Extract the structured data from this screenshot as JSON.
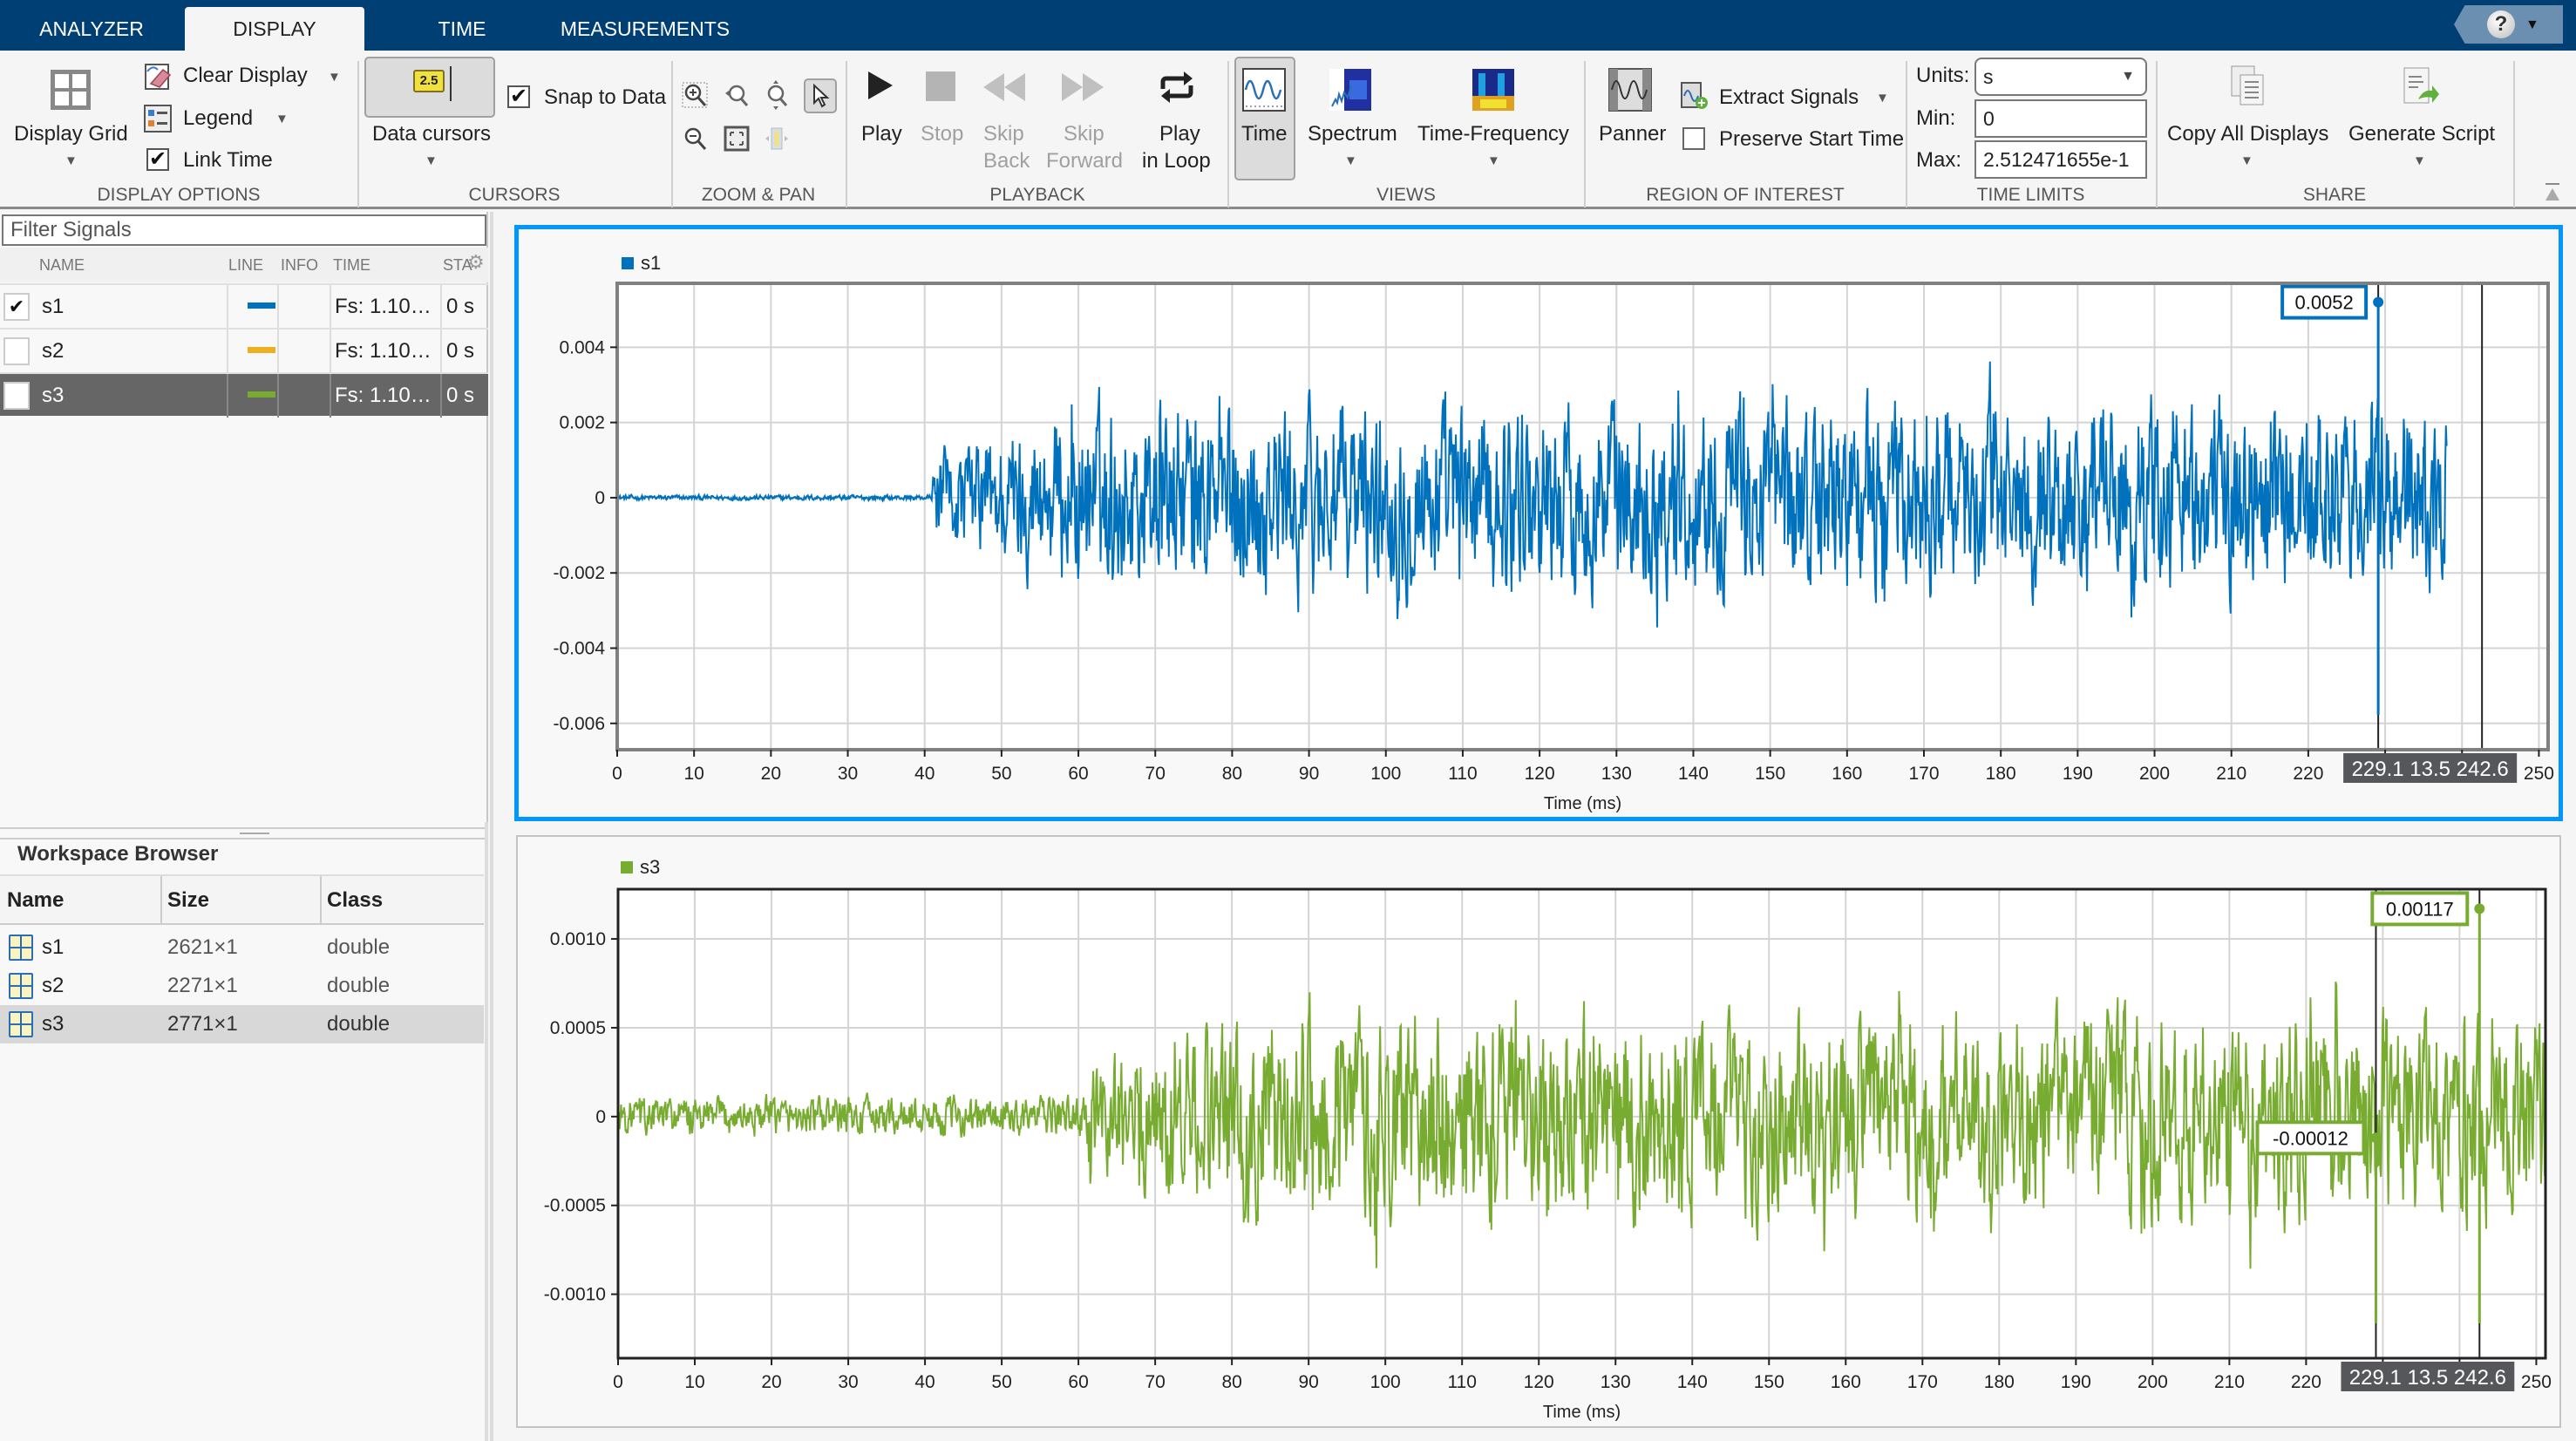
{
  "tabs": [
    {
      "label": "ANALYZER",
      "active": false
    },
    {
      "label": "DISPLAY",
      "active": true
    },
    {
      "label": "TIME",
      "active": false
    },
    {
      "label": "MEASUREMENTS",
      "active": false
    }
  ],
  "help_label": "?",
  "toolbar": {
    "display_options": {
      "section_label": "DISPLAY OPTIONS",
      "display_grid": "Display Grid",
      "clear_display": "Clear Display",
      "legend": "Legend",
      "link_time": "Link Time",
      "link_time_checked": true
    },
    "cursors": {
      "section_label": "CURSORS",
      "data_cursors": "Data cursors",
      "data_cursors_icon_text": "2.5",
      "snap_to_data": "Snap to Data",
      "snap_to_data_checked": true
    },
    "zoom_pan": {
      "section_label": "ZOOM & PAN"
    },
    "playback": {
      "section_label": "PLAYBACK",
      "play": "Play",
      "stop": "Stop",
      "skip_back_1": "Skip",
      "skip_back_2": "Back",
      "skip_forward_1": "Skip",
      "skip_forward_2": "Forward",
      "play_loop_1": "Play",
      "play_loop_2": "in Loop"
    },
    "views": {
      "section_label": "VIEWS",
      "time": "Time",
      "spectrum": "Spectrum",
      "time_frequency": "Time-Frequency"
    },
    "roi": {
      "section_label": "REGION OF INTEREST",
      "panner": "Panner",
      "extract_signals": "Extract Signals",
      "preserve_start_time": "Preserve Start Time",
      "preserve_start_time_checked": false
    },
    "time_limits": {
      "section_label": "TIME LIMITS",
      "units_label": "Units:",
      "units_value": "s",
      "min_label": "Min:",
      "min_value": "0",
      "max_label": "Max:",
      "max_value": "2.512471655e-1"
    },
    "share": {
      "section_label": "SHARE",
      "copy_all": "Copy All Displays",
      "generate_script": "Generate Script"
    }
  },
  "signals_panel": {
    "filter_placeholder": "Filter Signals",
    "columns": [
      "NAME",
      "LINE",
      "INFO",
      "TIME",
      "STA"
    ],
    "rows": [
      {
        "name": "s1",
        "checked": true,
        "color": "#0072bd",
        "time": "Fs: 1.10…",
        "start": "0 s",
        "selected": false
      },
      {
        "name": "s2",
        "checked": false,
        "color": "#edb120",
        "time": "Fs: 1.10…",
        "start": "0 s",
        "selected": false
      },
      {
        "name": "s3",
        "checked": false,
        "color": "#77ac30",
        "time": "Fs: 1.10…",
        "start": "0 s",
        "selected": true
      }
    ]
  },
  "workspace": {
    "title": "Workspace Browser",
    "columns": [
      "Name",
      "Size",
      "Class"
    ],
    "rows": [
      {
        "name": "s1",
        "size": "2621×1",
        "class": "double",
        "selected": false
      },
      {
        "name": "s2",
        "size": "2271×1",
        "class": "double",
        "selected": false
      },
      {
        "name": "s3",
        "size": "2771×1",
        "class": "double",
        "selected": true
      }
    ]
  },
  "chart_data": [
    {
      "type": "line",
      "title": "",
      "legend": [
        "s1"
      ],
      "legend_placement": "top-left",
      "color": "#0072bd",
      "xlabel": "Time (ms)",
      "ylabel": "",
      "xlim": [
        0,
        251.2
      ],
      "ylim": [
        -0.0067,
        0.0057
      ],
      "xticks": [
        0,
        10,
        20,
        30,
        40,
        50,
        60,
        70,
        80,
        90,
        100,
        110,
        120,
        130,
        140,
        150,
        160,
        170,
        180,
        190,
        200,
        210,
        220,
        230,
        240,
        250
      ],
      "xtick_labels": [
        "0",
        "10",
        "20",
        "30",
        "40",
        "50",
        "60",
        "70",
        "80",
        "90",
        "100",
        "110",
        "120",
        "130",
        "140",
        "150",
        "160",
        "170",
        "180",
        "190",
        "200",
        "210",
        "220",
        "",
        "",
        "250"
      ],
      "yticks": [
        -0.006,
        -0.004,
        -0.002,
        0,
        0.002,
        0.004
      ],
      "ytick_labels": [
        "-0.006",
        "-0.004",
        "-0.002",
        "0",
        "0.002",
        "0.004"
      ],
      "grid": true,
      "signal": {
        "quiet_until_ms": 41,
        "quiet_amp": 0.0001,
        "active_amp": 0.0035,
        "end_ms": 238
      },
      "cursors": {
        "t1": 229.1,
        "t2": 242.6,
        "dt": 13.5,
        "readout": [
          "229.1",
          "13.5",
          "242.6"
        ]
      },
      "data_cursor_labels": [
        {
          "value": "0.0052",
          "t": 229.1,
          "y": 0.0052
        }
      ]
    },
    {
      "type": "line",
      "title": "",
      "legend": [
        "s3"
      ],
      "legend_placement": "top-left",
      "color": "#77ac30",
      "xlabel": "Time (ms)",
      "ylabel": "",
      "xlim": [
        0,
        251.2
      ],
      "ylim": [
        -0.00136,
        0.00128
      ],
      "xticks": [
        0,
        10,
        20,
        30,
        40,
        50,
        60,
        70,
        80,
        90,
        100,
        110,
        120,
        130,
        140,
        150,
        160,
        170,
        180,
        190,
        200,
        210,
        220,
        230,
        240,
        250
      ],
      "xtick_labels": [
        "0",
        "10",
        "20",
        "30",
        "40",
        "50",
        "60",
        "70",
        "80",
        "90",
        "100",
        "110",
        "120",
        "130",
        "140",
        "150",
        "160",
        "170",
        "180",
        "190",
        "200",
        "210",
        "220",
        "",
        "",
        "250"
      ],
      "yticks": [
        -0.001,
        -0.0005,
        0,
        0.0005,
        0.001
      ],
      "ytick_labels": [
        "-0.0010",
        "-0.0005",
        "0",
        "0.0005",
        "0.0010"
      ],
      "grid": true,
      "signal": {
        "quiet_until_ms": 61,
        "quiet_amp": 0.00016,
        "active_amp": 0.0008,
        "end_ms": 251.2
      },
      "cursors": {
        "t1": 229.1,
        "t2": 242.6,
        "dt": 13.5,
        "readout": [
          "229.1",
          "13.5",
          "242.6"
        ]
      },
      "data_cursor_labels": [
        {
          "value": "0.00117",
          "t": 242.6,
          "y": 0.00117
        },
        {
          "value": "-0.00012",
          "t": 229.1,
          "y": -0.00012
        }
      ]
    }
  ]
}
